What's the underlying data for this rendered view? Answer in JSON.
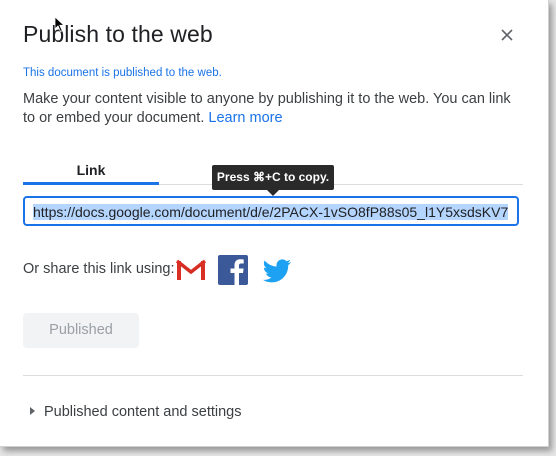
{
  "dialog": {
    "title": "Publish to the web",
    "status": "This document is published to the web.",
    "description": "Make your content visible to anyone by publishing it to the web. You can link to or embed your document.",
    "learn_more": "Learn more"
  },
  "tabs": [
    {
      "label": "Link",
      "active": true
    }
  ],
  "tooltip": "Press ⌘+C to copy.",
  "url_field": {
    "value": "https://docs.google.com/document/d/e/2PACX-1vSO8fP88s05_l1Y5xsdsKV7"
  },
  "share": {
    "label": "Or share this link using:",
    "icons": [
      "gmail-icon",
      "facebook-icon",
      "twitter-icon"
    ]
  },
  "published_button": "Published",
  "expander": "Published content and settings",
  "colors": {
    "accent": "#1a73e8",
    "gmail_red": "#d93025",
    "facebook_blue": "#3b5998",
    "twitter_blue": "#1da1f2"
  }
}
